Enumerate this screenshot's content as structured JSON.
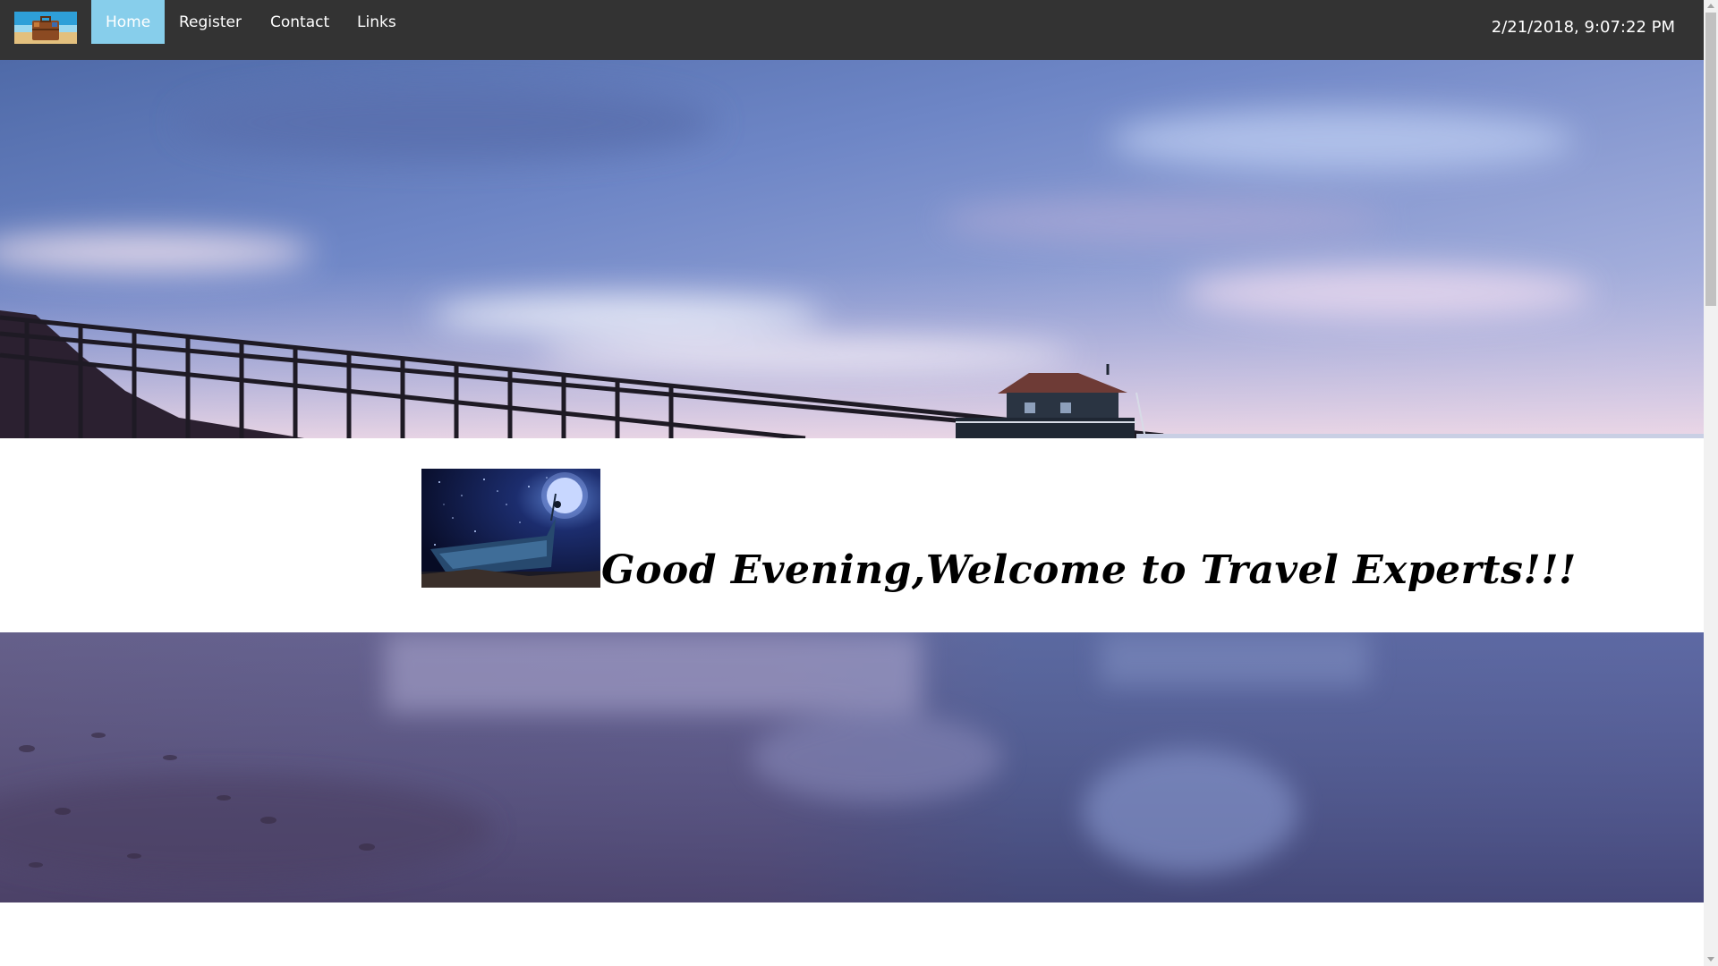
{
  "nav": {
    "logo_icon": "suitcase-beach-logo-icon",
    "items": [
      {
        "label": "Home",
        "active": true
      },
      {
        "label": "Register",
        "active": false
      },
      {
        "label": "Contact",
        "active": false
      },
      {
        "label": "Links",
        "active": false
      }
    ],
    "datetime": "2/21/2018, 9:07:22 PM"
  },
  "welcome": {
    "heading": "Good Evening,Welcome to Travel Experts!!!",
    "image_icon": "moonlit-boat-image"
  },
  "colors": {
    "navbar_bg": "#333333",
    "active_nav_bg": "#87ceeb",
    "nav_text": "#ffffff"
  }
}
